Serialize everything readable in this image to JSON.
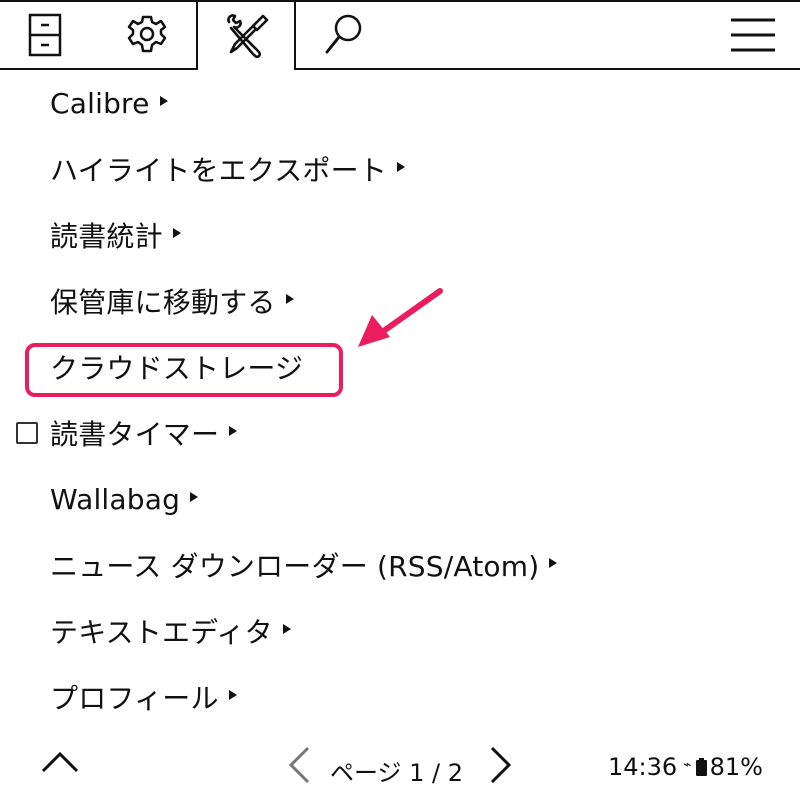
{
  "tabs": [
    {
      "name": "file-cabinet-icon",
      "active": false
    },
    {
      "name": "gear-icon",
      "active": false
    },
    {
      "name": "tools-icon",
      "active": true
    },
    {
      "name": "magnifier-icon",
      "active": false
    },
    {
      "name": "hamburger-icon",
      "active": false
    }
  ],
  "menu": {
    "items": [
      {
        "label": "Calibre",
        "submenu": true
      },
      {
        "label": "ハイライトをエクスポート",
        "submenu": true
      },
      {
        "label": "読書統計",
        "submenu": true
      },
      {
        "label": "保管庫に移動する",
        "submenu": true
      },
      {
        "label": "クラウドストレージ",
        "submenu": false
      },
      {
        "label": "読書タイマー",
        "submenu": true,
        "checkbox": true
      },
      {
        "label": "Wallabag",
        "submenu": true
      },
      {
        "label": "ニュース ダウンローダー (RSS/Atom)",
        "submenu": true
      },
      {
        "label": "テキストエディタ",
        "submenu": true
      },
      {
        "label": "プロフィール",
        "submenu": true
      }
    ]
  },
  "highlight": {
    "color": "#ec1d5f",
    "target": "クラウドストレージ"
  },
  "footer": {
    "page_label": "ページ 1 / 2",
    "time": "14:36",
    "battery": "81%"
  }
}
